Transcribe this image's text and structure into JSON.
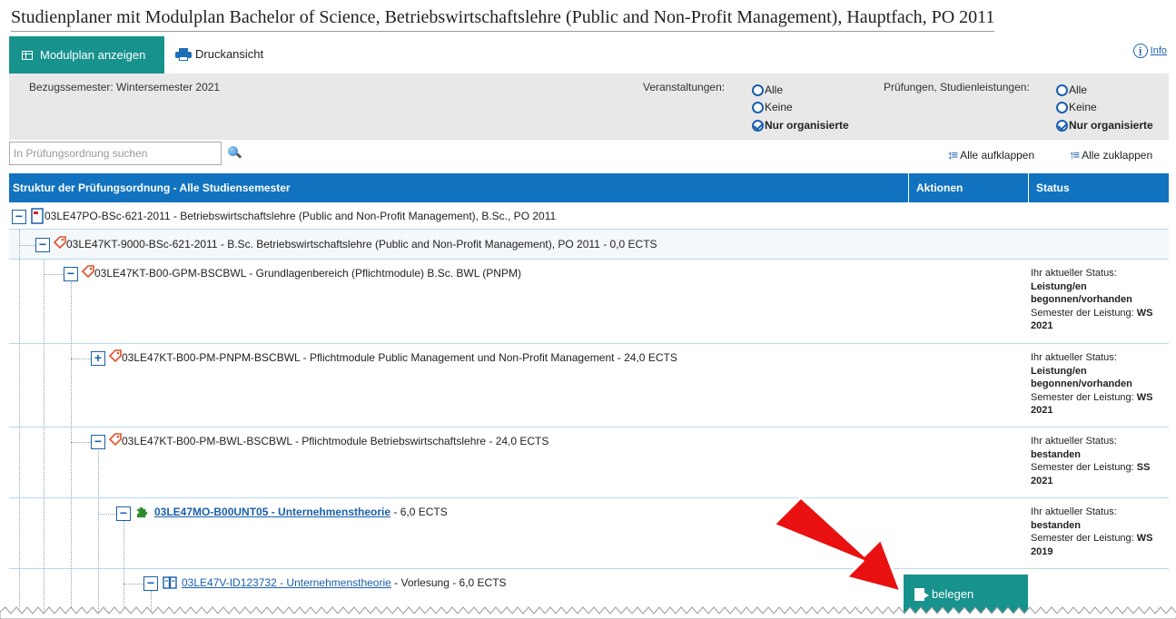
{
  "page": {
    "title": "Studienplaner mit Modulplan Bachelor of Science, Betriebswirtschaftslehre (Public and Non-Profit Management), Hauptfach, PO 2011"
  },
  "toolbar": {
    "modulplan_label": "Modulplan anzeigen",
    "druck_label": "Druckansicht",
    "info_label": "Info"
  },
  "filters": {
    "bezugssemester": "Bezugssemester: Wintersemester 2021",
    "veranstaltungen_label": "Veranstaltungen:",
    "pruefungen_label": "Prüfungen, Studienleistungen:",
    "veranstaltungen_options": [
      "Alle",
      "Keine",
      "Nur organisierte"
    ],
    "veranstaltungen_selected": "Nur organisierte",
    "pruefungen_options": [
      "Alle",
      "Keine",
      "Nur organisierte"
    ],
    "pruefungen_selected": "Nur organisierte"
  },
  "search": {
    "placeholder": "In Prüfungsordnung suchen",
    "expand_all": "Alle aufklappen",
    "collapse_all": "Alle zuklappen"
  },
  "table": {
    "col_structure": "Struktur der Prüfungsordnung - Alle Studiensemester",
    "col_actions": "Aktionen",
    "col_status": "Status"
  },
  "rows": [
    {
      "toggle": "−",
      "text": "03LE47PO-BSc-621-2011 - Betriebswirtschaftslehre (Public and Non-Profit Management), B.Sc., PO 2011"
    },
    {
      "toggle": "−",
      "text": "03LE47KT-9000-BSc-621-2011 - B.Sc. Betriebswirtschaftslehre (Public and Non-Profit Management), PO 2011 - 0,0 ECTS"
    },
    {
      "toggle": "−",
      "text": "03LE47KT-B00-GPM-BSCBWL - Grundlagenbereich (Pflichtmodule) B.Sc. BWL (PNPM)",
      "status_label": "Ihr aktueller Status:",
      "status_value": "Leistung/en begonnen/vorhanden",
      "semester_label": "Semester der Leistung:",
      "semester_value": "WS 2021"
    },
    {
      "toggle": "+",
      "text": "03LE47KT-B00-PM-PNPM-BSCBWL - Pflichtmodule Public Management und Non-Profit Management - 24,0 ECTS",
      "status_label": "Ihr aktueller Status:",
      "status_value": "Leistung/en begonnen/vorhanden",
      "semester_label": "Semester der Leistung:",
      "semester_value": "WS 2021"
    },
    {
      "toggle": "−",
      "text": "03LE47KT-B00-PM-BWL-BSCBWL - Pflichtmodule Betriebswirtschaftslehre - 24,0 ECTS",
      "status_label": "Ihr aktueller Status:",
      "status_value": "bestanden",
      "semester_label": "Semester der Leistung:",
      "semester_value": "SS 2021"
    },
    {
      "toggle": "−",
      "link": "03LE47MO-B00UNT05 - Unternehmenstheorie",
      "suffix": " - 6,0 ECTS",
      "status_label": "Ihr aktueller Status:",
      "status_value": "bestanden",
      "semester_label": "Semester der Leistung:",
      "semester_value": "WS 2019"
    },
    {
      "toggle": "−",
      "link": "03LE47V-ID123732 - Unternehmenstheorie",
      "suffix": " - Vorlesung - 6,0 ECTS"
    }
  ],
  "action": {
    "belegen_label": "belegen"
  },
  "colors": {
    "teal": "#17928c",
    "header_blue": "#1173c0",
    "link_blue": "#1a5fae",
    "arrow_red": "#e81010"
  },
  "icons": [
    "grid-icon",
    "printer-icon",
    "info-icon",
    "search-icon",
    "expand-all-icon",
    "collapse-all-icon",
    "document-icon",
    "tag-icon",
    "puzzle-icon",
    "book-icon",
    "door-enter-icon"
  ]
}
